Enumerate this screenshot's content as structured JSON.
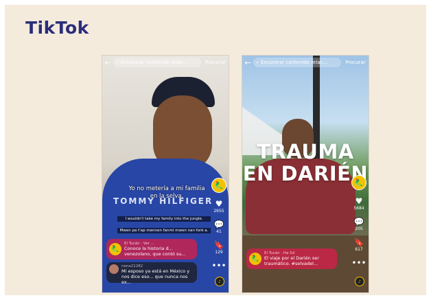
{
  "brand": {
    "logo_text": "TikTok",
    "logo_color": "#2b2d7a"
  },
  "phones": [
    {
      "search_placeholder": "Encontrar contenido relac...",
      "search_button": "Procurar",
      "subtitle_es": "Yo no metería a mi familia en la selva.",
      "subtitle_en": "I wouldn't take my family into the jungle.",
      "subtitle_ht": "Mwen pa t'ap mennen fanmi mwen nan forè a.",
      "shirt_text": "TOMMY HILFIGER",
      "likes": "2655",
      "comments": "41",
      "saves": "129",
      "promo_name": "El Tucán · Ver ...",
      "promo_text": "Conoce la historia d... venezolano, que contó su...",
      "comment_user": "nena21282",
      "comment_text": "Mi esposo ya está en México y nos dice eso... que nunca nos ex..."
    },
    {
      "search_placeholder": "Encontrar contenido relac...",
      "search_button": "Procurar",
      "title_overlay": "TRAUMA EN DARIÉN",
      "likes": "5684",
      "comments": "205",
      "saves": "617",
      "promo_name": "El Tucán · Ha 5d",
      "promo_text": "El viaje por el Darién ser traumático. #selvadel..."
    }
  ],
  "icons": {
    "back": "arrow-left-icon",
    "search": "search-icon",
    "like": "heart-icon",
    "comment": "comment-icon",
    "save": "bookmark-icon",
    "more": "more-icon",
    "warning": "warning-icon"
  },
  "accent_colors": {
    "promo": "#ce214a",
    "avatar": "#f2c200"
  }
}
